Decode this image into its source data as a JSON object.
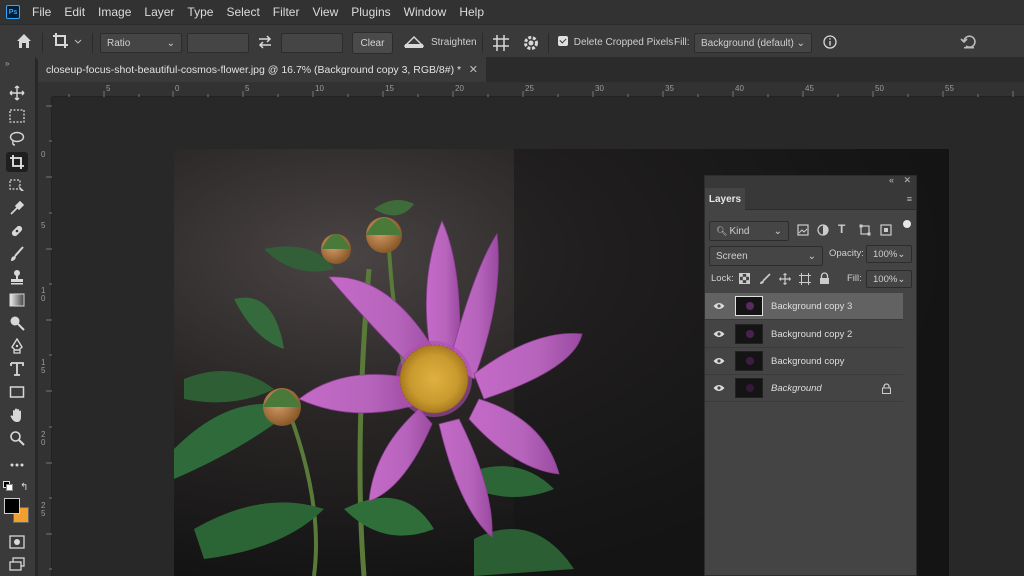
{
  "menubar": {
    "logo": "Ps",
    "items": [
      "File",
      "Edit",
      "Image",
      "Layer",
      "Type",
      "Select",
      "Filter",
      "View",
      "Plugins",
      "Window",
      "Help"
    ]
  },
  "options": {
    "ratio_value": "Ratio",
    "clear_label": "Clear",
    "straighten_label": "Straighten",
    "delete_cropped_label": "Delete Cropped Pixels",
    "delete_cropped_checked": true,
    "fill_label": "Fill:",
    "fill_value": "Background (default)"
  },
  "document": {
    "tab_title": "closeup-focus-shot-beautiful-cosmos-flower.jpg @ 16.7% (Background copy 3, RGB/8#) *"
  },
  "rulers": {
    "top": [
      "5",
      "0",
      "5",
      "10",
      "15",
      "20",
      "25",
      "30",
      "35",
      "40",
      "45",
      "50",
      "55"
    ],
    "left": [
      "0",
      "5",
      "1\n0",
      "1\n5",
      "2\n0",
      "2\n5"
    ]
  },
  "layers": {
    "tab_label": "Layers",
    "filter_value": "Kind",
    "blend_mode": "Screen",
    "opacity_label": "Opacity:",
    "opacity_value": "100%",
    "lock_label": "Lock:",
    "fill_label": "Fill:",
    "fill_value": "100%",
    "items": [
      {
        "name": "Background copy 3",
        "selected": true,
        "locked": false
      },
      {
        "name": "Background copy 2",
        "selected": false,
        "locked": false
      },
      {
        "name": "Background copy",
        "selected": false,
        "locked": false
      },
      {
        "name": "Background",
        "selected": false,
        "locked": true
      }
    ]
  },
  "colors": {
    "foreground": "#000000",
    "background": "#f0a030",
    "accent": "#31a8ff"
  }
}
